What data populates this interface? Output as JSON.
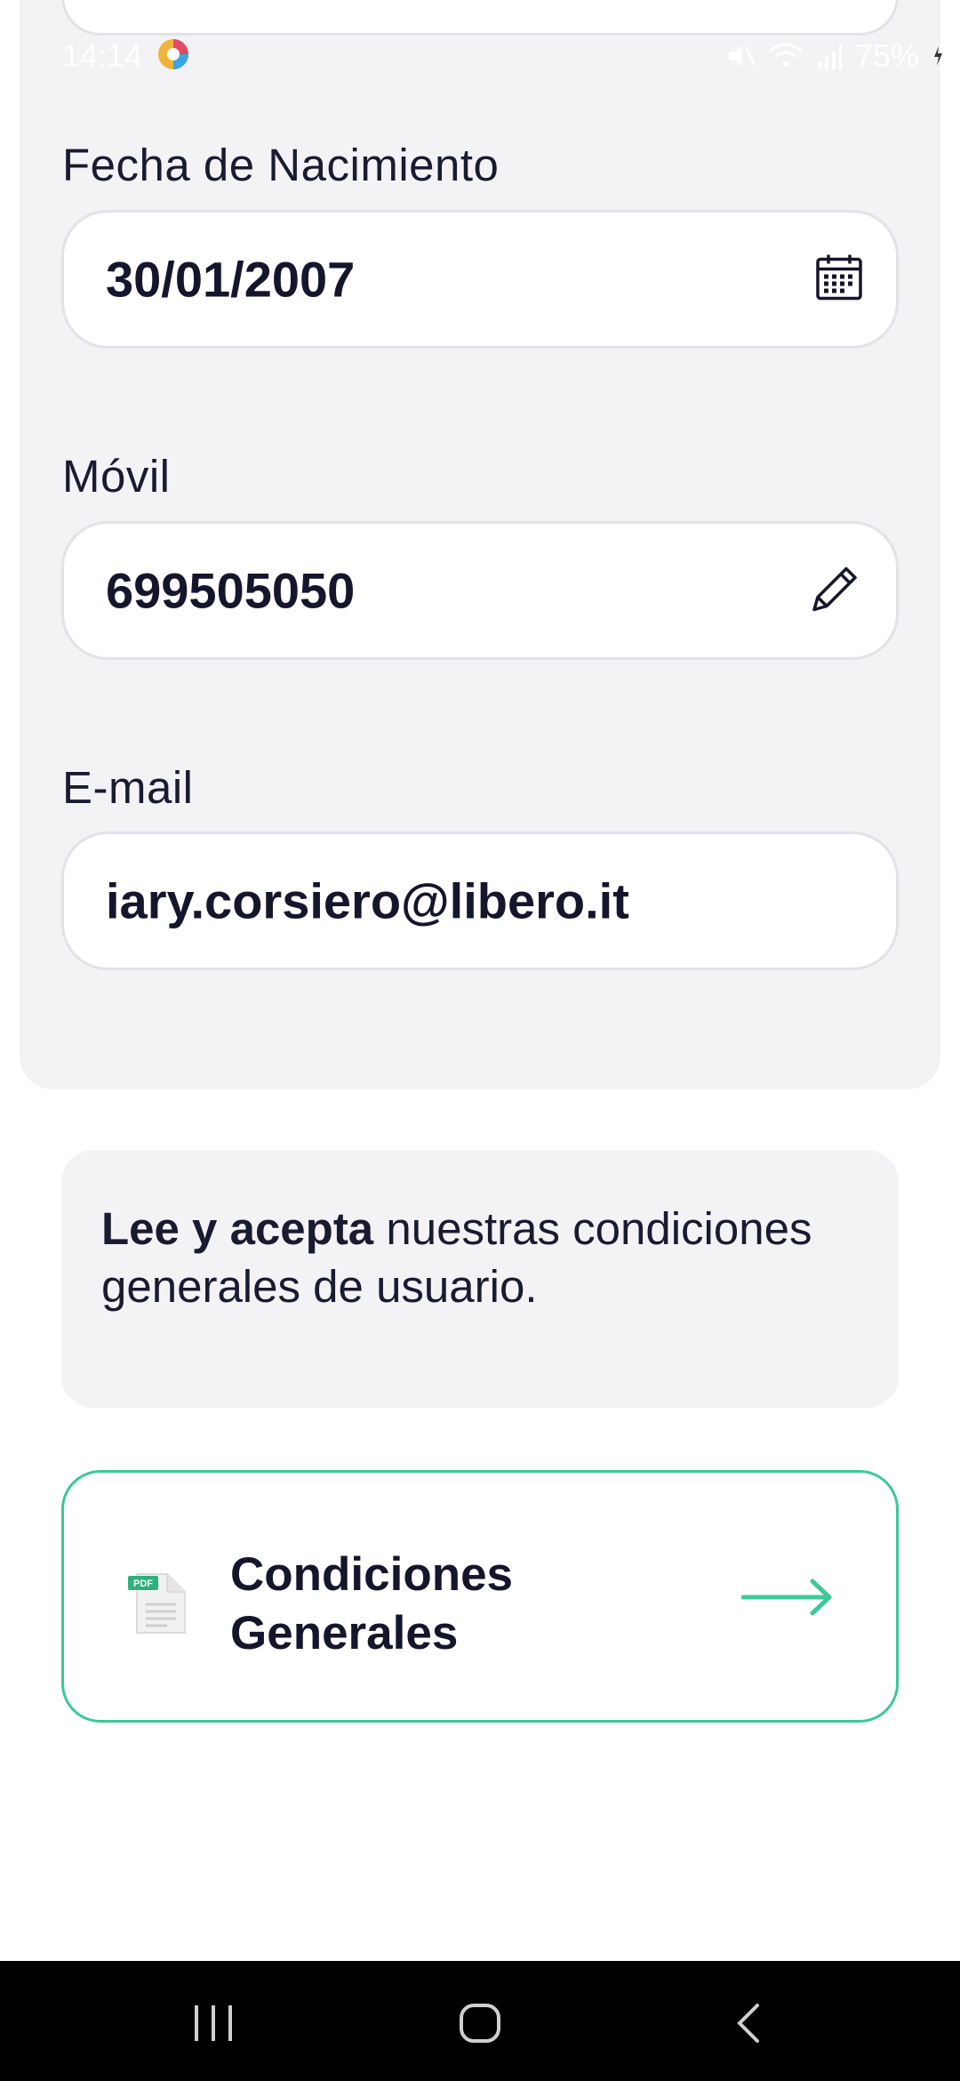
{
  "status_bar": {
    "time": "14:14",
    "battery": "75%"
  },
  "form": {
    "birthdate_label": "Fecha de Nacimiento",
    "birthdate_value": "30/01/2007",
    "mobile_label": "Móvil",
    "mobile_value": "699505050",
    "email_label": "E-mail",
    "email_value": "iary.corsiero@libero.it"
  },
  "terms": {
    "bold": "Lee y acepta",
    "rest": " nuestras condiciones generales de usuario."
  },
  "conditions_button": {
    "label": "Condiciones Generales",
    "icon_text": "PDF"
  },
  "colors": {
    "accent": "#3cc897",
    "card_bg": "#f3f3f6",
    "text": "#15162b"
  },
  "icons": {
    "calendar": "calendar-icon",
    "edit": "pencil-icon",
    "document": "pdf-document-icon",
    "arrow": "arrow-right-icon"
  }
}
